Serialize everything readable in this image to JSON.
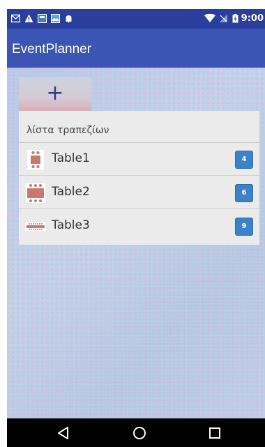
{
  "status_bar": {
    "time": "9:00",
    "icons": [
      "mail-icon",
      "warning-icon",
      "app-icon",
      "image-icon",
      "android-icon",
      "wifi-icon",
      "no-signal-icon",
      "battery-icon"
    ]
  },
  "app_bar": {
    "title": "EventPlanner"
  },
  "toolbar": {
    "add_label": "+"
  },
  "table_list": {
    "header": "λίστα τραπεζίων",
    "items": [
      {
        "label": "Table1",
        "count": "4",
        "icon": "small-table-icon"
      },
      {
        "label": "Table2",
        "count": "6",
        "icon": "medium-table-icon"
      },
      {
        "label": "Table3",
        "count": "9",
        "icon": "long-table-icon"
      }
    ]
  },
  "nav_bar": {
    "buttons": [
      "back-icon",
      "home-icon",
      "recents-icon"
    ]
  },
  "colors": {
    "status_bar": "#2a3f9d",
    "app_bar": "#3a55b4",
    "badge": "#3d82c6",
    "table_icon": "#c97a70"
  }
}
